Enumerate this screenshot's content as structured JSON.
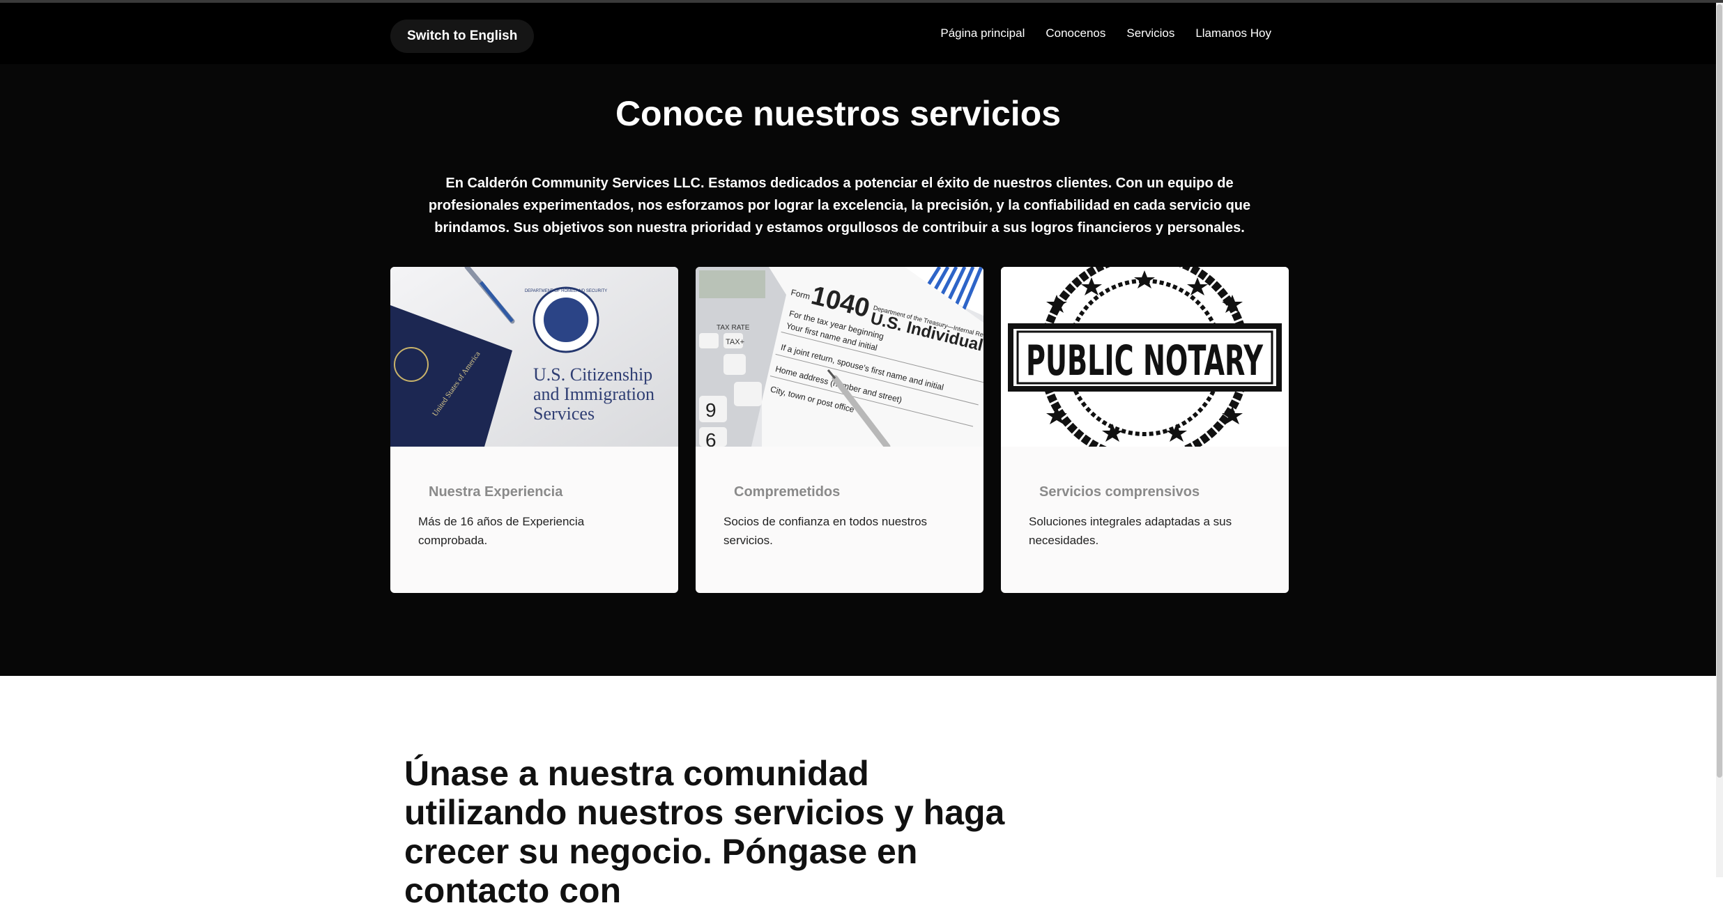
{
  "nav": {
    "lang_button": "Switch to English",
    "links": [
      "Página principal",
      "Conocenos",
      "Servicios",
      "Llamanos Hoy"
    ]
  },
  "services": {
    "title": "Conoce nuestros servicios",
    "intro": "En Calderón Community Services LLC. Estamos dedicados a potenciar el éxito de nuestros clientes. Con un equipo de profesionales experimentados, nos esforzamos por lograr la excelencia, la precisión, y la confiabilidad en cada servicio que brindamos. Sus objetivos son nuestra prioridad y estamos orgullosos de contribuir a sus logros financieros y personales.",
    "cards": [
      {
        "title": "Nuestra Experiencia",
        "desc": "Más de 16 años de Experiencia comprobada.",
        "image": {
          "line1": "U.S. Citizenship",
          "line2": "and Immigration",
          "line3": "Services",
          "passport_text": "United States of America",
          "seal_text": "DEPARTMENT OF HOMELAND SECURITY"
        }
      },
      {
        "title": "Compremetidos",
        "desc": "Socios de confianza en todos nuestros servicios.",
        "image": {
          "form_number": "1040",
          "form_title": "U.S. Individual Income",
          "form_label": "Form",
          "dept_text": "Department of the Treasury—Internal Revenue",
          "line_a": "For the tax year beginning",
          "line_b": "Your first name and initial",
          "line_c": "If a joint return, spouse's first name and initial",
          "line_d": "Home address (number and street)",
          "line_e": "City, town or post office",
          "calc_label_1": "TAX RATE",
          "calc_label_2": "TAX+",
          "calc_key_9": "9",
          "calc_key_6": "6"
        }
      },
      {
        "title": "Servicios comprensivos",
        "desc": "Soluciones integrales adaptadas a sus necesidades.",
        "image": {
          "stamp_text": "PUBLIC NOTARY"
        }
      }
    ]
  },
  "join": {
    "heading": "Únase a nuestra comunidad utilizando nuestros servicios y haga crecer su negocio. Póngase en contacto con"
  }
}
